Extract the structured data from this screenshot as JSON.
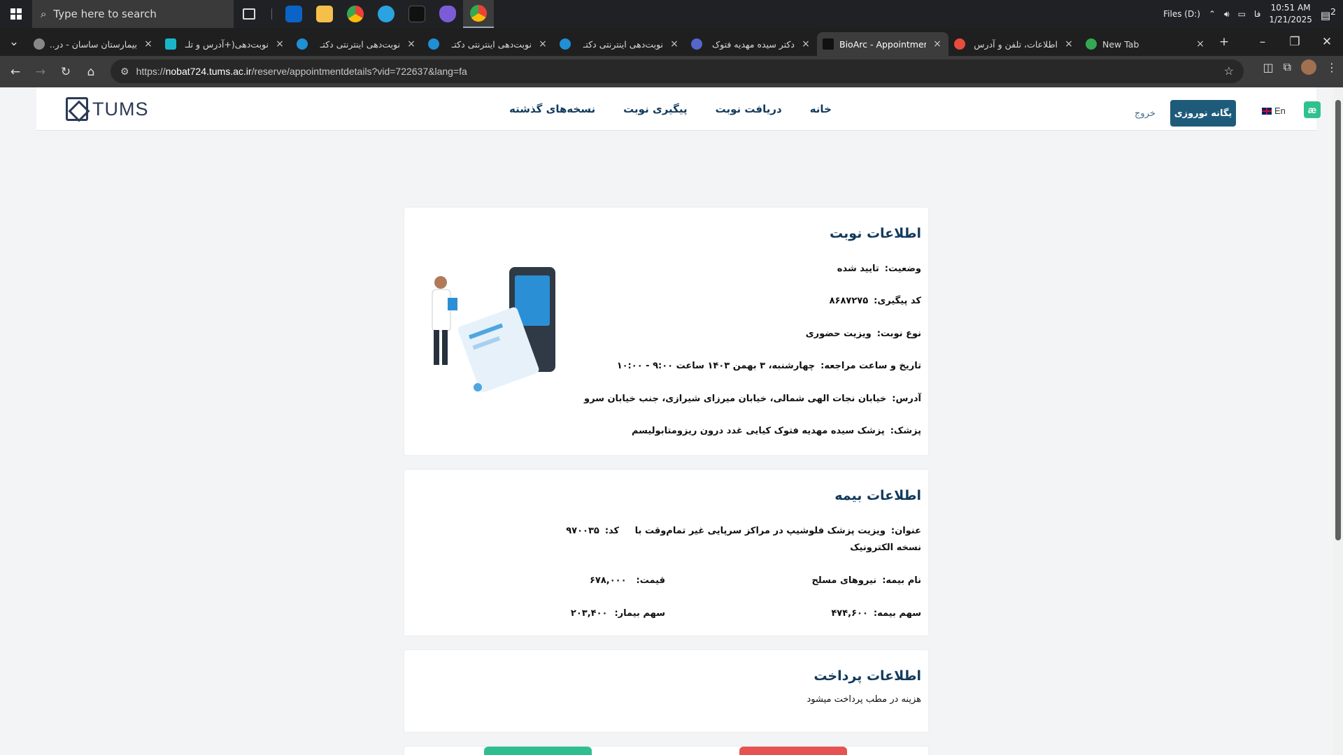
{
  "taskbar": {
    "search_placeholder": "Type here to search",
    "files_label": "Files (D:)",
    "lang_indicator": "فا",
    "time": "10:51 AM",
    "date": "1/21/2025",
    "notification_count": "2"
  },
  "tabs": [
    {
      "title": "بیمارستان ساسان - در...",
      "close": "×"
    },
    {
      "title": "نوبت‌دهی(+آدرس و تلـ",
      "close": "×"
    },
    {
      "title": "نوبت‌دهی اینترنتی دکتـ",
      "close": "×"
    },
    {
      "title": "نوبت‌دهی اینترنتی دکتـ",
      "close": "×"
    },
    {
      "title": "نوبت‌دهی اینترنتی دکتـ",
      "close": "×"
    },
    {
      "title": "دکتر سیده مهدیه فتوک",
      "close": "×"
    },
    {
      "title": "BioArc - Appointmen",
      "close": "×"
    },
    {
      "title": "اطلاعات، تلفن و آدرس",
      "close": "×"
    },
    {
      "title": "New Tab",
      "close": "×"
    }
  ],
  "address": {
    "prefix": "https://",
    "host": "nobat724.tums.ac.ir",
    "path": "/reserve/appointmentdetails?vid=722637&lang=fa"
  },
  "header": {
    "logo_text": "TUMS",
    "nav": [
      "خانه",
      "دریافت نوبت",
      "پیگیری نوبت",
      "نسخه‌های گذشته"
    ],
    "user_name": "یگانه نوروزی",
    "logout": "خروج",
    "lang": "En",
    "ae": "æ"
  },
  "appointment": {
    "title": "اطلاعات نوبت",
    "status_label": "وضعیت:",
    "status_value": "تایید شده",
    "code_label": "کد پیگیری:",
    "code_value": "۸۶۸۷۲۷۵",
    "type_label": "نوع نوبت:",
    "type_value": "ویزیت حضوری",
    "datetime_label": "تاریخ و ساعت مراجعه:",
    "datetime_value": "چهارشنبه، ۳ بهمن ۱۴۰۳ ساعت ۹:۰۰ - ۱۰:۰۰",
    "address_label": "آدرس:",
    "address_value": "خیابان نجات الهی شمالی، خیابان میرزای شیرازی، جنب خیابان سرو",
    "doctor_label": "پزشک:",
    "doctor_value": "پزشک سیده مهدیه فتوک کیایی غدد درون ریزومتابولیسم"
  },
  "insurance": {
    "title": "اطلاعات بیمه",
    "subject_label": "عنوان:",
    "subject_value": "ویزیت پزشک فلوشیپ در مراکز سرپایی غیر تمام‌وقت با",
    "subject_cont": "نسخه الکترونیک",
    "code_label": "کد:",
    "code_value": "۹۷۰۰۳۵",
    "name_label": "نام بیمه:",
    "name_value": "نیروهای مسلح",
    "price_label": "قیمت:",
    "price_value": "۶۷۸,۰۰۰",
    "ins_share_label": "سهم بیمه:",
    "ins_share_value": "۴۷۴,۶۰۰",
    "patient_share_label": "سهم بیمار:",
    "patient_share_value": "۲۰۳,۴۰۰"
  },
  "payment": {
    "title": "اطلاعات پرداخت",
    "note": "هزینه در مطب پرداخت میشود"
  }
}
